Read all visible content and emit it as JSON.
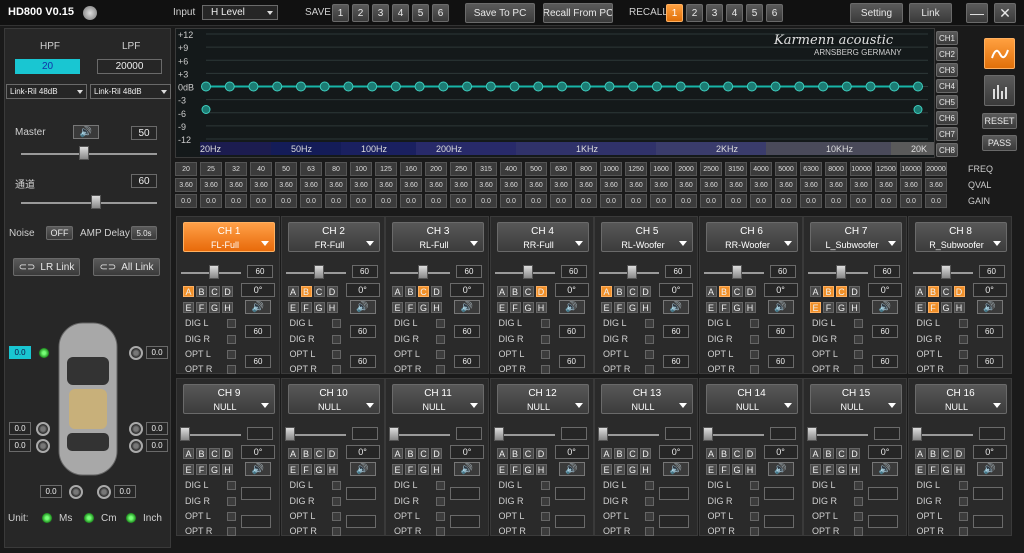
{
  "app": {
    "title": "HD800 V0.15"
  },
  "header": {
    "input_label": "Input",
    "input_value": "H Level",
    "save_label": "SAVE",
    "save_slots": [
      "1",
      "2",
      "3",
      "4",
      "5",
      "6"
    ],
    "save_to_pc": "Save To PC",
    "recall_from_pc": "Recall From PC",
    "recall_label": "RECALL",
    "recall_slots": [
      "1",
      "2",
      "3",
      "4",
      "5",
      "6"
    ],
    "recall_active": "1",
    "setting": "Setting",
    "link": "Link"
  },
  "left": {
    "hpf_label": "HPF",
    "lpf_label": "LPF",
    "hpf_value": "20",
    "lpf_value": "20000",
    "hpf_type": "Link-Ril 48dB",
    "lpf_type": "Link-Ril 48dB",
    "master_label": "Master",
    "master_value": "50",
    "second_label": "通道",
    "second_value": "60",
    "noise_label": "Noise",
    "noise_value": "OFF",
    "amp_delay_label": "AMP Delay",
    "amp_delay_value": "5.0s",
    "lr_link": "LR Link",
    "all_link": "All Link",
    "pos_values": [
      "0.0",
      "0.0",
      "0.0",
      "0.0",
      "0.0",
      "0.0",
      "0.0",
      "0.0"
    ],
    "unit_label": "Unit:",
    "units": [
      "Ms",
      "Cm",
      "Inch"
    ]
  },
  "eq": {
    "brand": "Karmenn acoustic",
    "brand_sub": "ARNSBERG GERMANY",
    "y_labels": [
      "+12",
      "+9",
      "+6",
      "+3",
      "0dB",
      "-3",
      "-6",
      "-9",
      "-12"
    ],
    "x_labels": [
      "20Hz",
      "50Hz",
      "100Hz",
      "200Hz",
      "1KHz",
      "2KHz",
      "10KHz",
      "20K"
    ],
    "point_count": 31
  },
  "right": {
    "channels": [
      "CH1",
      "CH2",
      "CH3",
      "CH4",
      "CH5",
      "CH6",
      "CH7",
      "CH8"
    ],
    "reset": "RESET",
    "pass": "PASS"
  },
  "table": {
    "freq_label": "FREQ",
    "qval_label": "QVAL",
    "gain_label": "GAIN",
    "freqs": [
      "20",
      "25",
      "32",
      "40",
      "50",
      "63",
      "80",
      "100",
      "125",
      "160",
      "200",
      "250",
      "315",
      "400",
      "500",
      "630",
      "800",
      "1000",
      "1250",
      "1600",
      "2000",
      "2500",
      "3150",
      "4000",
      "5000",
      "6300",
      "8000",
      "10000",
      "12500",
      "16000",
      "20000"
    ],
    "q": "3.60",
    "gain": "0.0"
  },
  "channels": [
    {
      "name": "CH 1",
      "mode": "FL-Full",
      "active": true,
      "level": "60",
      "phase": "0°",
      "abcd": "A",
      "efgh": ""
    },
    {
      "name": "CH 2",
      "mode": "FR-Full",
      "active": false,
      "level": "60",
      "phase": "0°",
      "abcd": "B",
      "efgh": ""
    },
    {
      "name": "CH 3",
      "mode": "RL-Full",
      "active": false,
      "level": "60",
      "phase": "0°",
      "abcd": "C",
      "efgh": ""
    },
    {
      "name": "CH 4",
      "mode": "RR-Full",
      "active": false,
      "level": "60",
      "phase": "0°",
      "abcd": "D",
      "efgh": ""
    },
    {
      "name": "CH 5",
      "mode": "RL-Woofer",
      "active": false,
      "level": "60",
      "phase": "0°",
      "abcd": "A",
      "efgh": ""
    },
    {
      "name": "CH 6",
      "mode": "RR-Woofer",
      "active": false,
      "level": "60",
      "phase": "0°",
      "abcd": "B",
      "efgh": ""
    },
    {
      "name": "CH 7",
      "mode": "L_Subwoofer",
      "active": false,
      "level": "60",
      "phase": "0°",
      "abcd": "BC",
      "efgh": "E"
    },
    {
      "name": "CH 8",
      "mode": "R_Subwoofer",
      "active": false,
      "level": "60",
      "phase": "0°",
      "abcd": "BD",
      "efgh": "F"
    },
    {
      "name": "CH 9",
      "mode": "NULL",
      "active": false,
      "level": "",
      "phase": "0°",
      "abcd": "",
      "efgh": ""
    },
    {
      "name": "CH 10",
      "mode": "NULL",
      "active": false,
      "level": "",
      "phase": "0°",
      "abcd": "",
      "efgh": ""
    },
    {
      "name": "CH 11",
      "mode": "NULL",
      "active": false,
      "level": "",
      "phase": "0°",
      "abcd": "",
      "efgh": ""
    },
    {
      "name": "CH 12",
      "mode": "NULL",
      "active": false,
      "level": "",
      "phase": "0°",
      "abcd": "",
      "efgh": ""
    },
    {
      "name": "CH 13",
      "mode": "NULL",
      "active": false,
      "level": "",
      "phase": "0°",
      "abcd": "",
      "efgh": ""
    },
    {
      "name": "CH 14",
      "mode": "NULL",
      "active": false,
      "level": "",
      "phase": "0°",
      "abcd": "",
      "efgh": ""
    },
    {
      "name": "CH 15",
      "mode": "NULL",
      "active": false,
      "level": "",
      "phase": "0°",
      "abcd": "",
      "efgh": ""
    },
    {
      "name": "CH 16",
      "mode": "NULL",
      "active": false,
      "level": "",
      "phase": "0°",
      "abcd": "",
      "efgh": ""
    }
  ],
  "dig_labels": [
    "DIG L",
    "DIG R",
    "OPT L",
    "OPT R"
  ],
  "colors": {
    "accent": "#f0902a",
    "eq_line": "#17b5a8",
    "hpf_field": "#19c6d2"
  }
}
